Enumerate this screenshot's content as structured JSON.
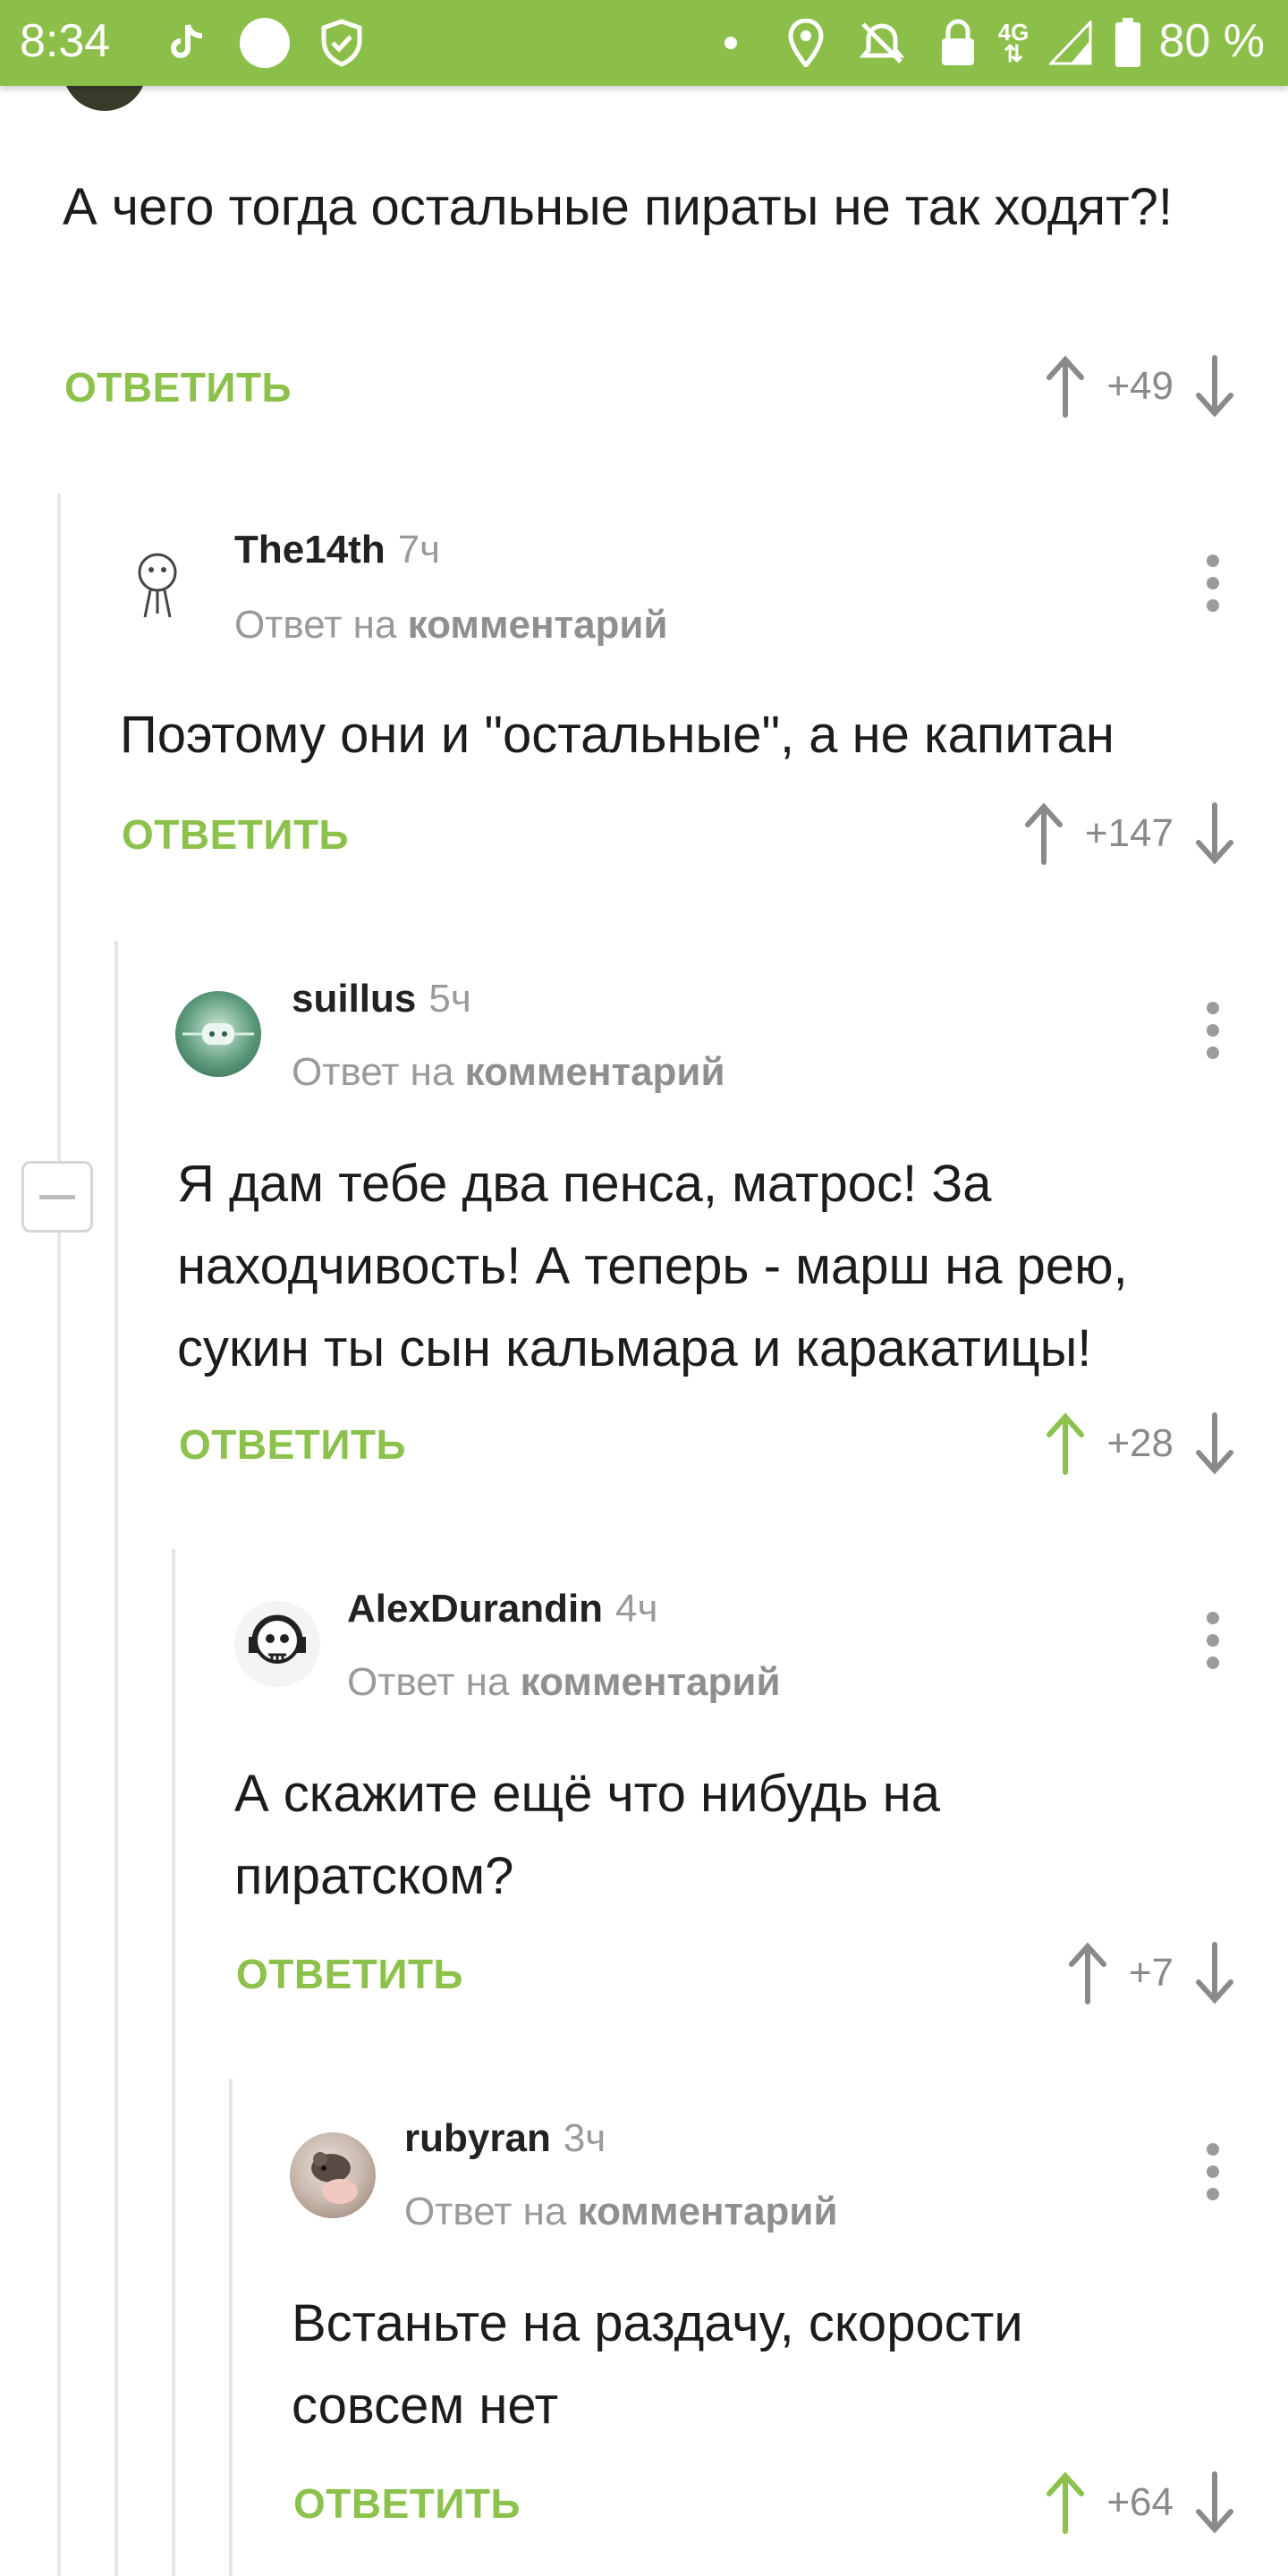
{
  "status_bar": {
    "time": "8:34",
    "battery": "80 %",
    "icons": [
      "tiktok-icon",
      "circle-notification-icon",
      "shield-icon",
      "dot-icon",
      "location-icon",
      "alarm-off-icon",
      "lock-icon",
      "4g-lte-icon",
      "signal-icon",
      "battery-icon"
    ]
  },
  "colors": {
    "accent": "#8cc14c",
    "status_bar": "#8cbf4a",
    "muted": "#9a9a9a",
    "thread_line": "#e5e5e5"
  },
  "comments": [
    {
      "text": "А чего тогда остальные пираты не так ходят?!",
      "reply_label": "ОТВЕТИТЬ",
      "votes": "+49",
      "upvoted": false
    },
    {
      "author": "The14th",
      "time": "7ч",
      "reply_prefix": "Ответ на",
      "reply_target": "комментарий",
      "text": "Поэтому они и \"остальные\", а не капитан",
      "reply_label": "ОТВЕТИТЬ",
      "votes": "+147",
      "upvoted": false
    },
    {
      "author": "suillus",
      "time": "5ч",
      "reply_prefix": "Ответ на",
      "reply_target": "комментарий",
      "text": "Я дам тебе два пенса, матрос! За находчивость! А теперь - марш на рею, сукин ты сын кальмара и каракатицы!",
      "reply_label": "ОТВЕТИТЬ",
      "votes": "+28",
      "upvoted": true
    },
    {
      "author": "AlexDurandin",
      "time": "4ч",
      "reply_prefix": "Ответ на",
      "reply_target": "комментарий",
      "text": "А скажите ещё что нибудь на пиратском?",
      "reply_label": "ОТВЕТИТЬ",
      "votes": "+7",
      "upvoted": false
    },
    {
      "author": "rubyran",
      "time": "3ч",
      "reply_prefix": "Ответ на",
      "reply_target": "комментарий",
      "text": "Встаньте на раздачу, скорости совсем нет",
      "reply_label": "ОТВЕТИТЬ",
      "votes": "+64",
      "upvoted": true
    }
  ]
}
